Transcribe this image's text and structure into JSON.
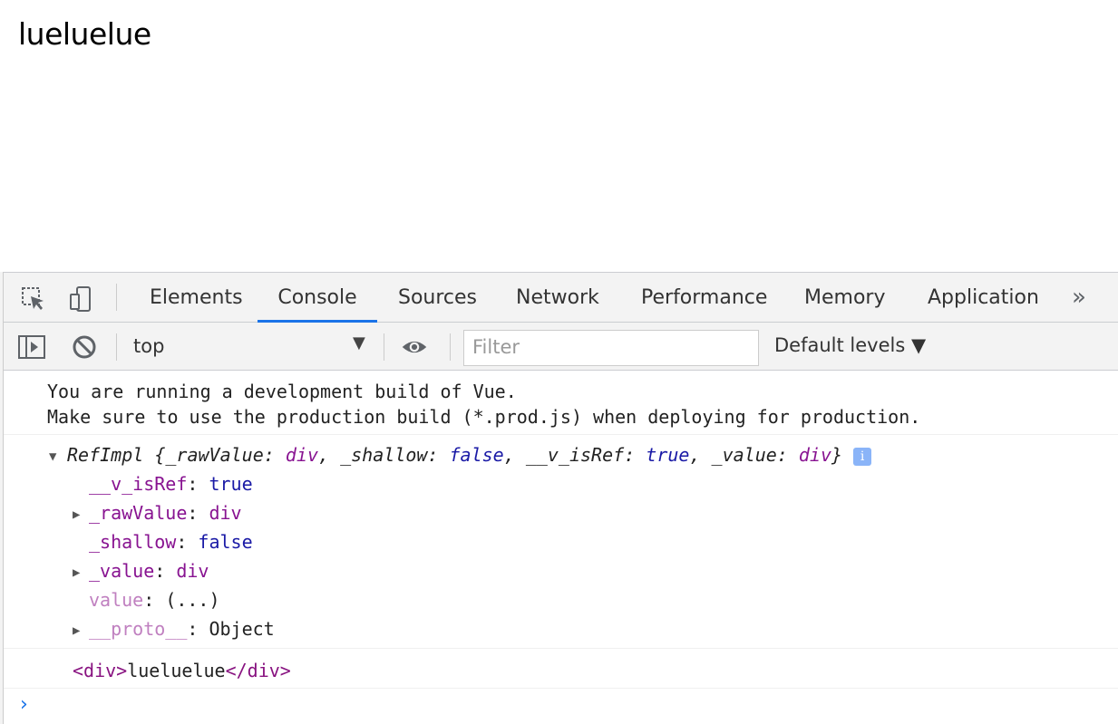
{
  "page": {
    "text": "lueluelue"
  },
  "devtools": {
    "tabs": [
      "Elements",
      "Console",
      "Sources",
      "Network",
      "Performance",
      "Memory",
      "Application"
    ],
    "active_tab": "Console",
    "more_label": "»"
  },
  "toolbar": {
    "context": "top",
    "filter_placeholder": "Filter",
    "levels": "Default levels ▼"
  },
  "console": {
    "vue_warning_line1": "You are running a development build of Vue.",
    "vue_warning_line2": "Make sure to use the production build (*.prod.js) when deploying for production.",
    "refimpl": {
      "class": "RefImpl",
      "k1": "_rawValue",
      "v1": "div",
      "k2": "_shallow",
      "v2": "false",
      "k3": "__v_isRef",
      "v3": "true",
      "k4": "_value",
      "v4": "div"
    },
    "props": [
      {
        "key": "__v_isRef",
        "val": "true"
      },
      {
        "key": "_rawValue",
        "val": "div"
      },
      {
        "key": "_shallow",
        "val": "false"
      },
      {
        "key": "_value",
        "val": "div"
      },
      {
        "key": "value",
        "val": "(...)"
      },
      {
        "key": "__proto__",
        "val": "Object"
      }
    ],
    "element_log": {
      "open_tag": "<div>",
      "content": "lueluelue",
      "close_tag": "</div>"
    }
  },
  "colors": {
    "accent": "#1a73e8",
    "key": "#881391",
    "bool": "#1a1aa6"
  }
}
